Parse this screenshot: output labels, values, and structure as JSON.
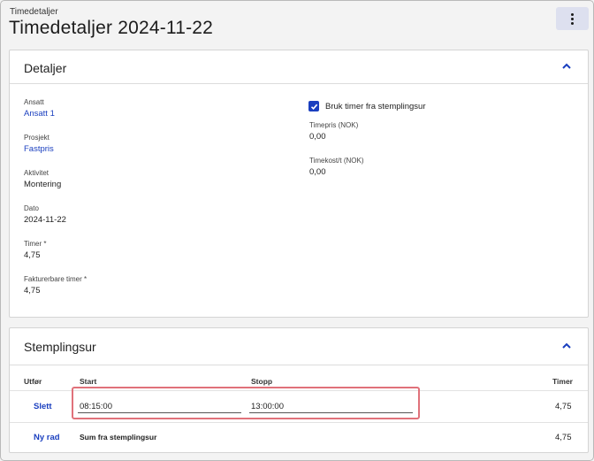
{
  "header": {
    "breadcrumb": "Timedetaljer",
    "title": "Timedetaljer 2024-11-22"
  },
  "details": {
    "section_title": "Detaljer",
    "employee": {
      "label": "Ansatt",
      "value": "Ansatt 1"
    },
    "project": {
      "label": "Prosjekt",
      "value": "Fastpris"
    },
    "activity": {
      "label": "Aktivitet",
      "value": "Montering"
    },
    "date": {
      "label": "Dato",
      "value": "2024-11-22"
    },
    "hours": {
      "label": "Timer *",
      "value": "4,75"
    },
    "billable_hours": {
      "label": "Fakturerbare timer *",
      "value": "4,75"
    },
    "use_clock_checkbox": {
      "label": "Bruk timer fra stemplingsur",
      "checked": true
    },
    "hourly_rate": {
      "label": "Timepris (NOK)",
      "value": "0,00"
    },
    "hourly_cost": {
      "label": "Timekost/t (NOK)",
      "value": "0,00"
    }
  },
  "clock": {
    "section_title": "Stemplingsur",
    "columns": {
      "action": "Utfør",
      "start": "Start",
      "stop": "Stopp",
      "hours": "Timer"
    },
    "rows": [
      {
        "action": "Slett",
        "start": "08:15:00",
        "stop": "13:00:00",
        "hours": "4,75"
      }
    ],
    "footer": {
      "action": "Ny rad",
      "label": "Sum fra stemplingsur",
      "hours": "4,75"
    }
  },
  "colors": {
    "accent": "#1a3fbf",
    "highlight": "#e0717a",
    "menu_bg": "#dde0ef"
  },
  "icons": {
    "menu": "kebab-menu-icon",
    "collapse": "chevron-up-icon",
    "check": "checkmark-icon"
  }
}
